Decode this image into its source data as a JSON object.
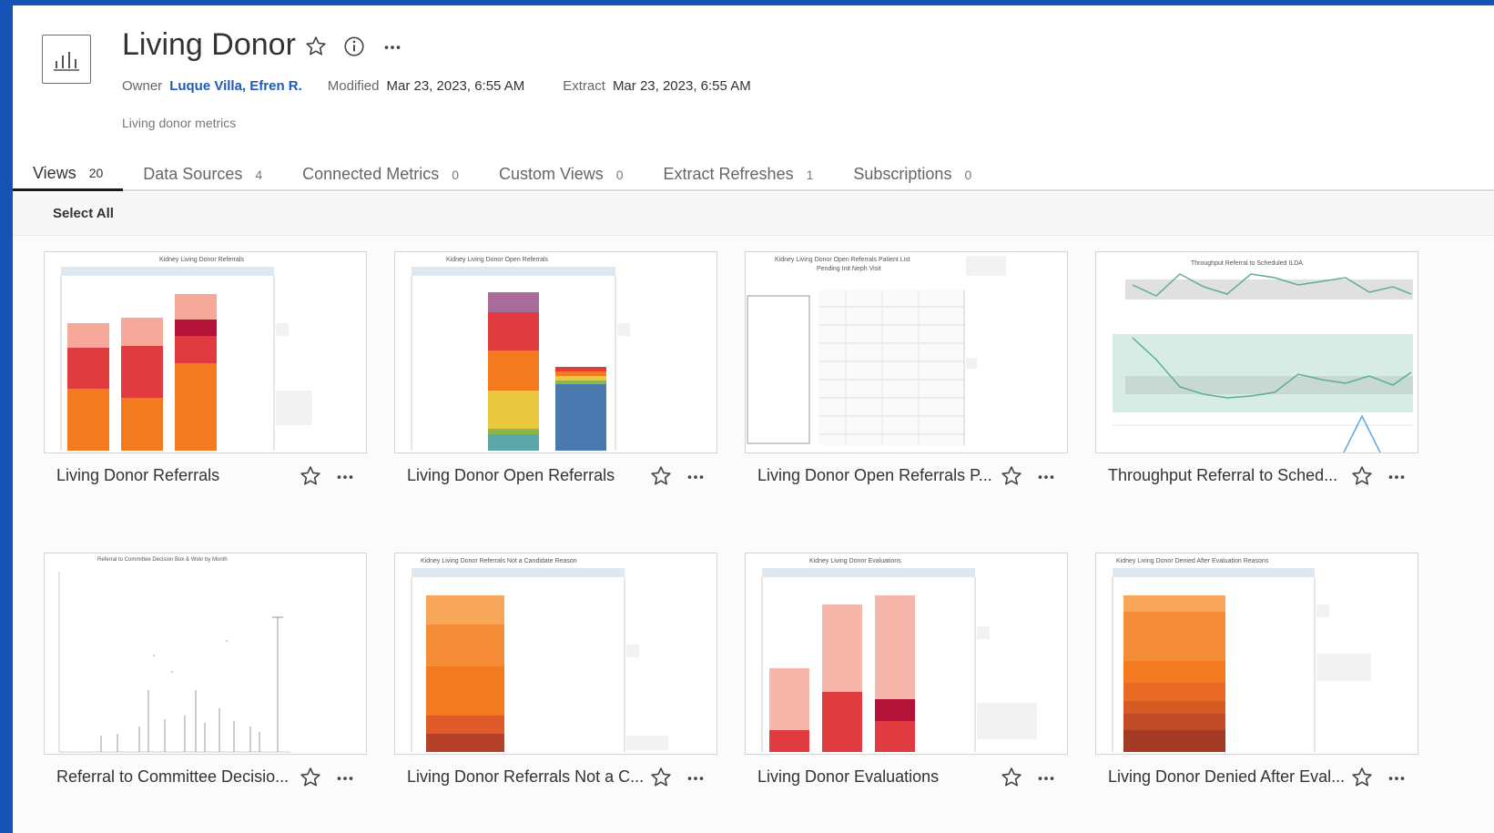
{
  "workbook": {
    "title": "Living Donor",
    "owner_label": "Owner",
    "owner": "Luque Villa, Efren R.",
    "modified_label": "Modified",
    "modified": "Mar 23, 2023, 6:55 AM",
    "extract_label": "Extract",
    "extract": "Mar 23, 2023, 6:55 AM",
    "description": "Living donor metrics"
  },
  "tabs": [
    {
      "label": "Views",
      "count": "20"
    },
    {
      "label": "Data Sources",
      "count": "4"
    },
    {
      "label": "Connected Metrics",
      "count": "0"
    },
    {
      "label": "Custom Views",
      "count": "0"
    },
    {
      "label": "Extract Refreshes",
      "count": "1"
    },
    {
      "label": "Subscriptions",
      "count": "0"
    }
  ],
  "toolbar": {
    "select_all": "Select All"
  },
  "views": [
    {
      "name": "Living Donor Referrals",
      "thumb_title": "Kidney Living Donor Referrals"
    },
    {
      "name": "Living Donor Open Referrals",
      "thumb_title": "Kidney Living Donor Open Referrals"
    },
    {
      "name": "Living Donor Open Referrals P...",
      "thumb_title": "Kidney Living Donor Open Referrals Patient List",
      "thumb_subtitle": "Pending Init Neph Visit"
    },
    {
      "name": "Throughput Referral to Sched...",
      "thumb_title": "Throughput Referral to Scheduled ILDA"
    },
    {
      "name": "Referral to Committee Decisio...",
      "thumb_title": "Referral to Committee Decision Box & Wskr by Month"
    },
    {
      "name": "Living Donor Referrals Not a C...",
      "thumb_title": "Kidney Living Donor Referrals Not a Candidate Reason"
    },
    {
      "name": "Living Donor Evaluations",
      "thumb_title": "Kidney Living Donor Evaluations"
    },
    {
      "name": "Living Donor Denied After Eval...",
      "thumb_title": "Kidney Living Donor Denied After Evaluation Reasons"
    }
  ],
  "colors": {
    "accent_blue": "#1553b6",
    "owner_link": "#1f5ab8",
    "orange": "#f47a20",
    "red": "#e03c3f",
    "salmon": "#f6a89a",
    "dark_red": "#b5123a",
    "teal_band": "#d8ece6",
    "green_line": "#5db08a"
  }
}
